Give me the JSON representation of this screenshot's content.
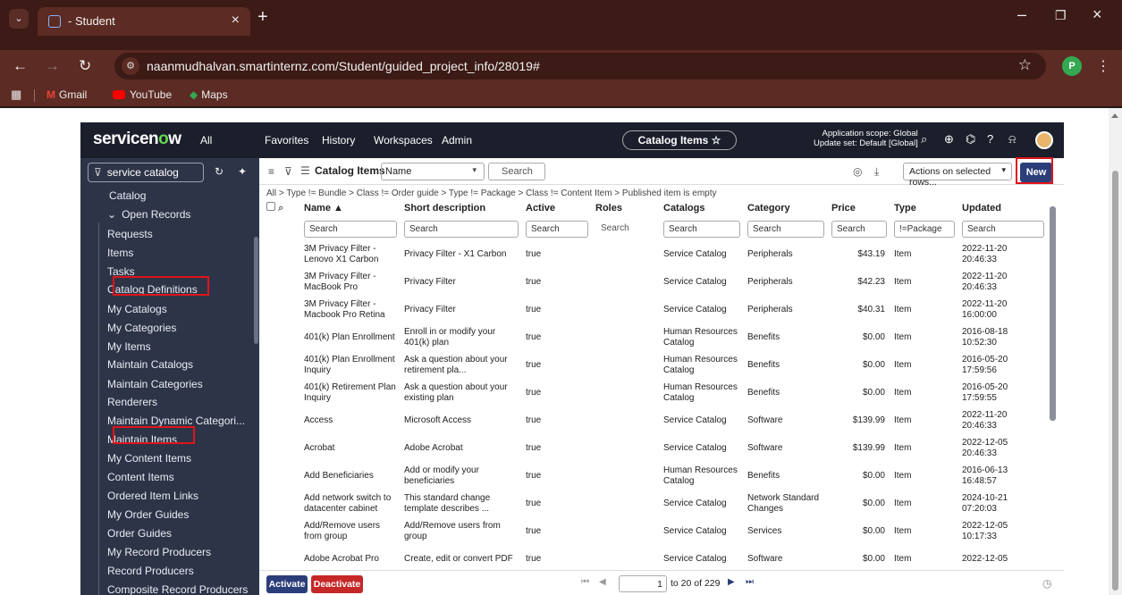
{
  "browser": {
    "tab_title": "- Student",
    "url": "naanmudhalvan.smartinternz.com/Student/guided_project_info/28019#",
    "profile_initial": "P",
    "bookmarks": [
      "Gmail",
      "YouTube",
      "Maps"
    ]
  },
  "header": {
    "logo_text_a": "servicen",
    "logo_text_o": "o",
    "logo_text_b": "w",
    "all_label": "All",
    "nav": [
      "Favorites",
      "History",
      "Workspaces",
      "Admin"
    ],
    "context_pill": "Catalog Items ☆",
    "scope_line1": "Application scope: Global",
    "scope_line2": "Update set: Default [Global]"
  },
  "sidebar": {
    "filter_value": "service catalog",
    "items": [
      "Catalog",
      "Open Records",
      "Requests",
      "Items",
      "Tasks",
      "Catalog Definitions",
      "My Catalogs",
      "My Categories",
      "My Items",
      "Maintain Catalogs",
      "Maintain Categories",
      "Renderers",
      "Maintain Dynamic Categori...",
      "Maintain Items",
      "My Content Items",
      "Content Items",
      "Ordered Item Links",
      "My Order Guides",
      "Order Guides",
      "My Record Producers",
      "Record Producers",
      "Composite Record Producers"
    ]
  },
  "list": {
    "title": "Catalog Items",
    "search_field": "Name",
    "search_placeholder": "Search",
    "actions_label": "Actions on selected rows...",
    "new_label": "New",
    "breadcrumb": "All > Type != Bundle > Class != Order guide > Type != Package > Class != Content Item > Published item is empty",
    "columns": [
      "Name ▲",
      "Short description",
      "Active",
      "Roles",
      "Catalogs",
      "Category",
      "Price",
      "Type",
      "Updated"
    ],
    "search_row": [
      "Search",
      "Search",
      "Search",
      "Search",
      "Search",
      "Search",
      "Search",
      "!=Package",
      "Search"
    ],
    "rows": [
      [
        "3M Privacy Filter - Lenovo X1 Carbon",
        "Privacy Filter - X1 Carbon",
        "true",
        "",
        "Service Catalog",
        "Peripherals",
        "$43.19",
        "Item",
        "2022-11-20 20:46:33"
      ],
      [
        "3M Privacy Filter - MacBook Pro",
        "Privacy Filter",
        "true",
        "",
        "Service Catalog",
        "Peripherals",
        "$42.23",
        "Item",
        "2022-11-20 20:46:33"
      ],
      [
        "3M Privacy Filter - Macbook Pro Retina",
        "Privacy Filter",
        "true",
        "",
        "Service Catalog",
        "Peripherals",
        "$40.31",
        "Item",
        "2022-11-20 16:00:00"
      ],
      [
        "401(k) Plan Enrollment",
        "Enroll in or modify your 401(k) plan",
        "true",
        "",
        "Human Resources Catalog",
        "Benefits",
        "$0.00",
        "Item",
        "2016-08-18 10:52:30"
      ],
      [
        "401(k) Plan Enrollment Inquiry",
        "Ask a question about your retirement pla...",
        "true",
        "",
        "Human Resources Catalog",
        "Benefits",
        "$0.00",
        "Item",
        "2016-05-20 17:59:56"
      ],
      [
        "401(k) Retirement Plan Inquiry",
        "Ask a question about your existing plan",
        "true",
        "",
        "Human Resources Catalog",
        "Benefits",
        "$0.00",
        "Item",
        "2016-05-20 17:59:55"
      ],
      [
        "Access",
        "Microsoft Access",
        "true",
        "",
        "Service Catalog",
        "Software",
        "$139.99",
        "Item",
        "2022-11-20 20:46:33"
      ],
      [
        "Acrobat",
        "Adobe Acrobat",
        "true",
        "",
        "Service Catalog",
        "Software",
        "$139.99",
        "Item",
        "2022-12-05 20:46:33"
      ],
      [
        "Add Beneficiaries",
        "Add or modify your beneficiaries",
        "true",
        "",
        "Human Resources Catalog",
        "Benefits",
        "$0.00",
        "Item",
        "2016-06-13 16:48:57"
      ],
      [
        "Add network switch to datacenter cabinet",
        "This standard change template describes ...",
        "true",
        "",
        "Service Catalog",
        "Network Standard Changes",
        "$0.00",
        "Item",
        "2024-10-21 07:20:03"
      ],
      [
        "Add/Remove users from group",
        "Add/Remove users from group",
        "true",
        "",
        "Service Catalog",
        "Services",
        "$0.00",
        "Item",
        "2022-12-05 10:17:33"
      ],
      [
        "Adobe Acrobat Pro",
        "Create, edit or convert PDF",
        "true",
        "",
        "Service Catalog",
        "Software",
        "$0.00",
        "Item",
        "2022-12-05"
      ]
    ]
  },
  "footer": {
    "activate_label": "Activate",
    "deactivate_label": "Deactivate",
    "page_value": "1",
    "range_text": "to 20 of 229"
  }
}
